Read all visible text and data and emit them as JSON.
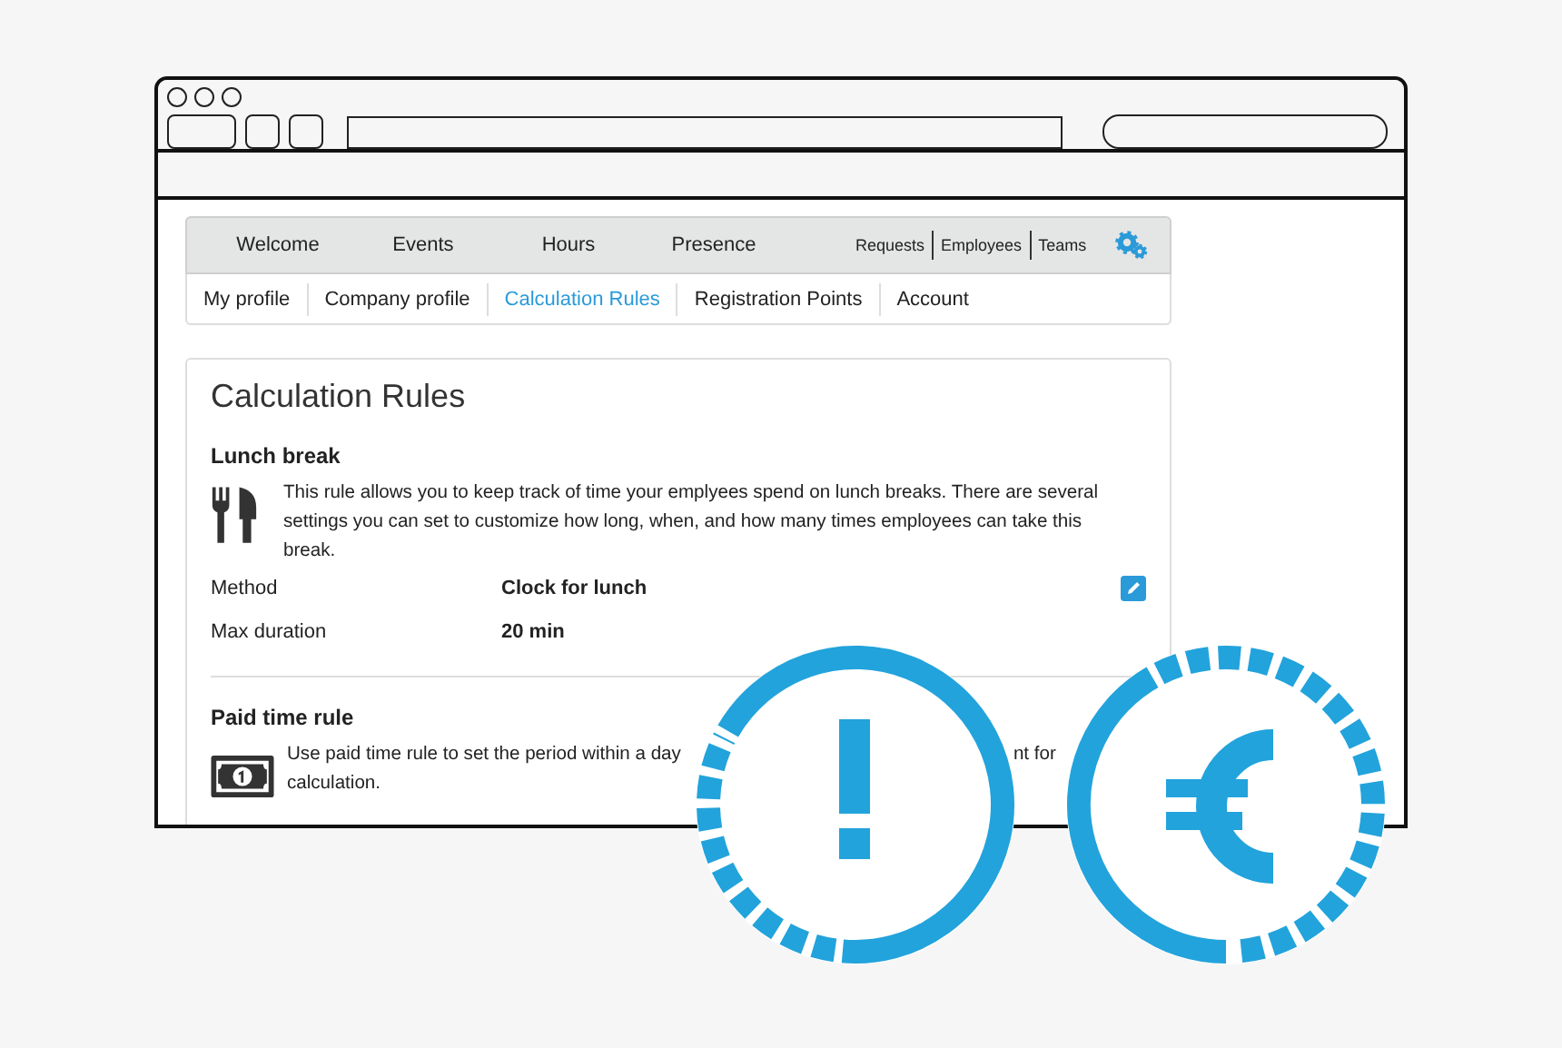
{
  "nav": {
    "main": [
      {
        "label": "Welcome",
        "selected": false
      },
      {
        "label": "Events",
        "selected": false
      },
      {
        "label": "Hours",
        "selected": false
      },
      {
        "label": "Presence",
        "selected": false
      }
    ],
    "secondary": [
      "Requests",
      "Employees",
      "Teams"
    ]
  },
  "subnav": [
    {
      "label": "My profile",
      "selected": false
    },
    {
      "label": "Company profile",
      "selected": false
    },
    {
      "label": "Calculation Rules",
      "selected": true
    },
    {
      "label": "Registration Points",
      "selected": false
    },
    {
      "label": "Account",
      "selected": false
    }
  ],
  "page_title": "Calculation Rules",
  "rules": [
    {
      "kind": "cutlery",
      "title": "Lunch break",
      "description": [
        "This rule allows you to keep track of time your emplyees spend on lunch breaks. There are several settings you can set to customize how long, when, and how many times employees can take this break."
      ],
      "settings": [
        {
          "label": "Method",
          "value": "Clock for lunch",
          "editable": true
        },
        {
          "label": "Max duration",
          "value": "20 min",
          "editable": false
        }
      ]
    },
    {
      "kind": "money",
      "title": "Paid time rule",
      "description": [
        "Use paid time rule to set the period within a day",
        "nt for",
        "calculation."
      ]
    }
  ],
  "badges": [
    {
      "kind": "alert"
    },
    {
      "kind": "euro"
    }
  ]
}
